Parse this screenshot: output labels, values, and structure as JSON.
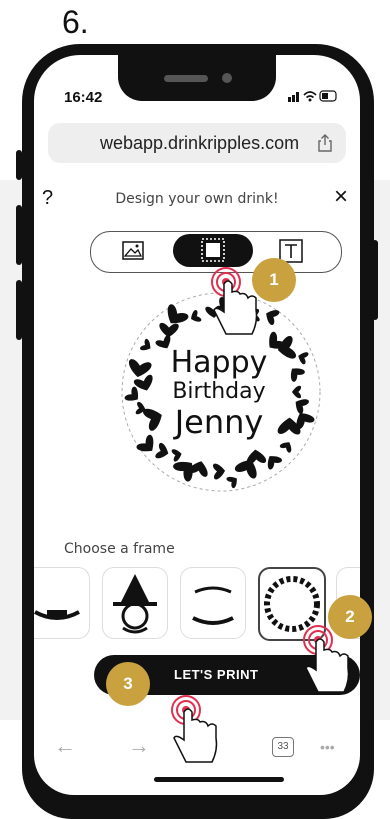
{
  "step_label": "6.",
  "status": {
    "time": "16:42",
    "icons": "signal wifi battery"
  },
  "browser": {
    "url": "webapp.drinkripples.com",
    "share_icon": "share-icon"
  },
  "app": {
    "help": "?",
    "title": "Design your own drink!",
    "close": "×",
    "toggle": [
      "image-mode",
      "frame-mode",
      "text-mode"
    ],
    "active_toggle": "frame-mode"
  },
  "design": {
    "line1": "Happy",
    "line2": "Birthday",
    "line3": "Jenny"
  },
  "frames": {
    "heading": "Choose a frame",
    "count": 5,
    "selected_index": 3
  },
  "print": {
    "label": "LET'S PRINT"
  },
  "bottom_nav": {
    "tabs": "33",
    "more": "•••"
  },
  "badges": [
    "1",
    "2",
    "3"
  ],
  "accent_color": "#c9a13f"
}
